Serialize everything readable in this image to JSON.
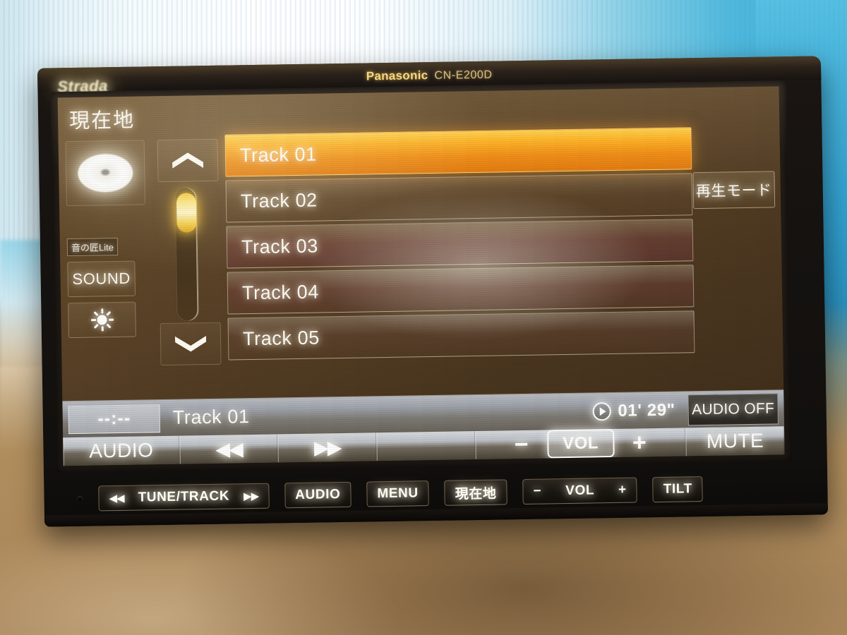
{
  "device": {
    "sub_brand": "Strada",
    "brand": "Panasonic",
    "model": "CN-E200D"
  },
  "screen": {
    "title": "現在地",
    "left_rail": {
      "disc_icon": "cd-disc-icon",
      "oto_label": "音の匠Lite",
      "sound_label": "SOUND",
      "brightness_icon": "brightness-sun-icon"
    },
    "scroll": {
      "up_icon": "chevron-up-icon",
      "down_icon": "chevron-down-icon",
      "thumb_position_percent": 4
    },
    "track_list": [
      {
        "label": "Track 01",
        "selected": true
      },
      {
        "label": "Track 02",
        "selected": false
      },
      {
        "label": "Track 03",
        "selected": false
      },
      {
        "label": "Track 04",
        "selected": false
      },
      {
        "label": "Track 05",
        "selected": false
      }
    ],
    "right_rail": {
      "play_mode_label": "再生モード"
    },
    "status_bar": {
      "clock": "--:--",
      "now_playing": "Track 01",
      "play_icon": "play-circle-icon",
      "elapsed": "01' 29\"",
      "audio_off_label": "AUDIO OFF"
    },
    "control_bar": [
      {
        "name": "audio",
        "label": "AUDIO"
      },
      {
        "name": "prev-track",
        "label": "◀◀"
      },
      {
        "name": "next-track",
        "label": "▶▶"
      },
      {
        "name": "blank",
        "label": ""
      },
      {
        "name": "vol-minus",
        "label": "−"
      },
      {
        "name": "vol",
        "label": "VOL"
      },
      {
        "name": "vol-plus",
        "label": "+"
      },
      {
        "name": "mute",
        "label": "MUTE"
      }
    ]
  },
  "hardware_buttons": {
    "tune_track": {
      "prev": "◀◀",
      "label": "TUNE/TRACK",
      "next": "▶▶"
    },
    "audio": "AUDIO",
    "menu": "MENU",
    "current_location": "現在地",
    "vol_minus": "−",
    "vol": "VOL",
    "vol_plus": "+",
    "tilt": "TILT"
  },
  "colors": {
    "selected_track_top": "#ffd14a",
    "selected_track_bottom": "#e3790c",
    "scroll_thumb": "#f9c93a",
    "brand_gold": "#f6d77a"
  }
}
